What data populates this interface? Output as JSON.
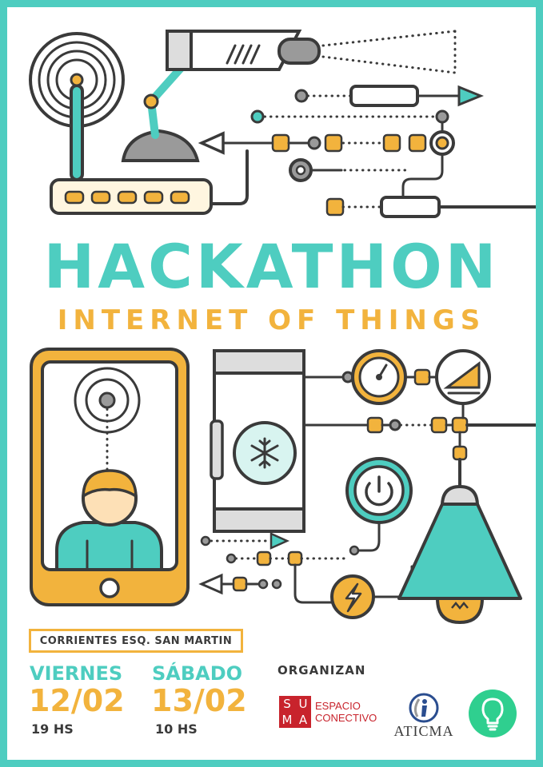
{
  "title": "HACKATHON",
  "subtitle": "INTERNET OF THINGS",
  "address": "CORRIENTES ESQ. SAN MARTIN",
  "schedule": [
    {
      "day": "VIERNES",
      "date": "12/02",
      "time": "19 HS"
    },
    {
      "day": "SÁBADO",
      "date": "13/02",
      "time": "10 HS"
    }
  ],
  "organizers": {
    "label": "ORGANIZAN",
    "suma": {
      "letters": [
        "S",
        "U",
        "M",
        "A"
      ],
      "line1": "ESPACIO",
      "line2": "CONECTIVO"
    },
    "aticma": {
      "name": "ATICMA"
    }
  },
  "colors": {
    "teal": "#4ecdc0",
    "yellow": "#f2b33d",
    "dark": "#3a3a3a",
    "gray": "#9a9a9a",
    "suma_red": "#c8232c"
  },
  "icons": [
    "wifi-router-icon",
    "security-camera-icon",
    "smartphone-icon",
    "user-icon",
    "fridge-icon",
    "snowflake-icon",
    "gauge-icon",
    "signal-icon",
    "power-icon",
    "lightning-icon",
    "lamp-icon",
    "lightbulb-icon"
  ]
}
